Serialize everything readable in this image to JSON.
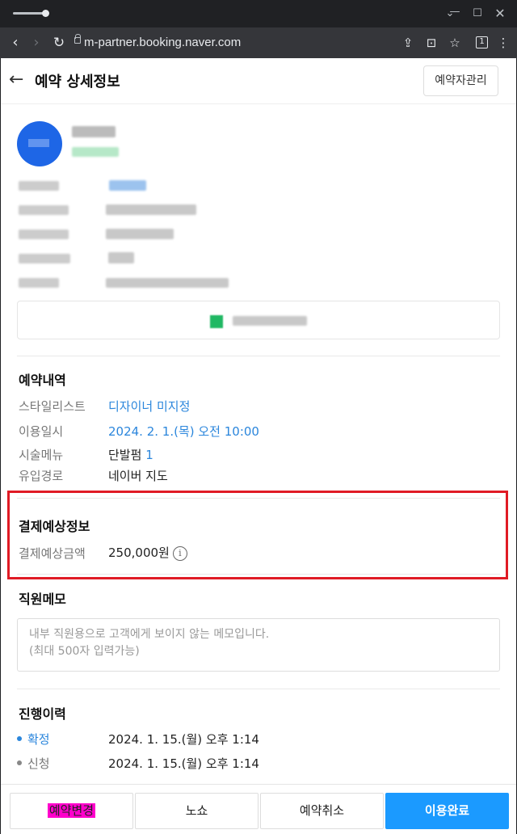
{
  "browser": {
    "url": "m-partner.booking.naver.com",
    "tab_count": "1"
  },
  "header": {
    "title": "예약 상세정보",
    "manage_button": "예약자관리"
  },
  "reservation": {
    "title": "예약내역",
    "rows": [
      {
        "label": "스타일리스트",
        "value": "디자이너 미지정"
      },
      {
        "label": "이용일시",
        "value": "2024. 2. 1.(목) 오전 10:00"
      },
      {
        "label": "시술메뉴",
        "value": "단발펌",
        "count": "1"
      },
      {
        "label": "유입경로",
        "value": "네이버 지도"
      }
    ]
  },
  "payment": {
    "title": "결제예상정보",
    "label": "결제예상금액",
    "amount": "250,000원",
    "info_glyph": "i"
  },
  "memo": {
    "title": "직원메모",
    "placeholder": "내부 직원용으로 고객에게 보이지 않는 메모입니다.\n(최대 500자 입력가능)"
  },
  "history": {
    "title": "진행이력",
    "items": [
      {
        "status": "확정",
        "datetime": "2024. 1. 15.(월) 오후 1:14",
        "color": "#2b86dc"
      },
      {
        "status": "신청",
        "datetime": "2024. 1. 15.(월) 오후 1:14",
        "color": "#888888"
      }
    ]
  },
  "actions": {
    "change": "예약변경",
    "noshow": "노쇼",
    "cancel": "예약취소",
    "complete": "이용완료"
  },
  "colors": {
    "accent_blue": "#1b9aff",
    "link_blue": "#2b86dc",
    "highlight_red": "#e01b25",
    "avatar_blue": "#1e66e6"
  }
}
